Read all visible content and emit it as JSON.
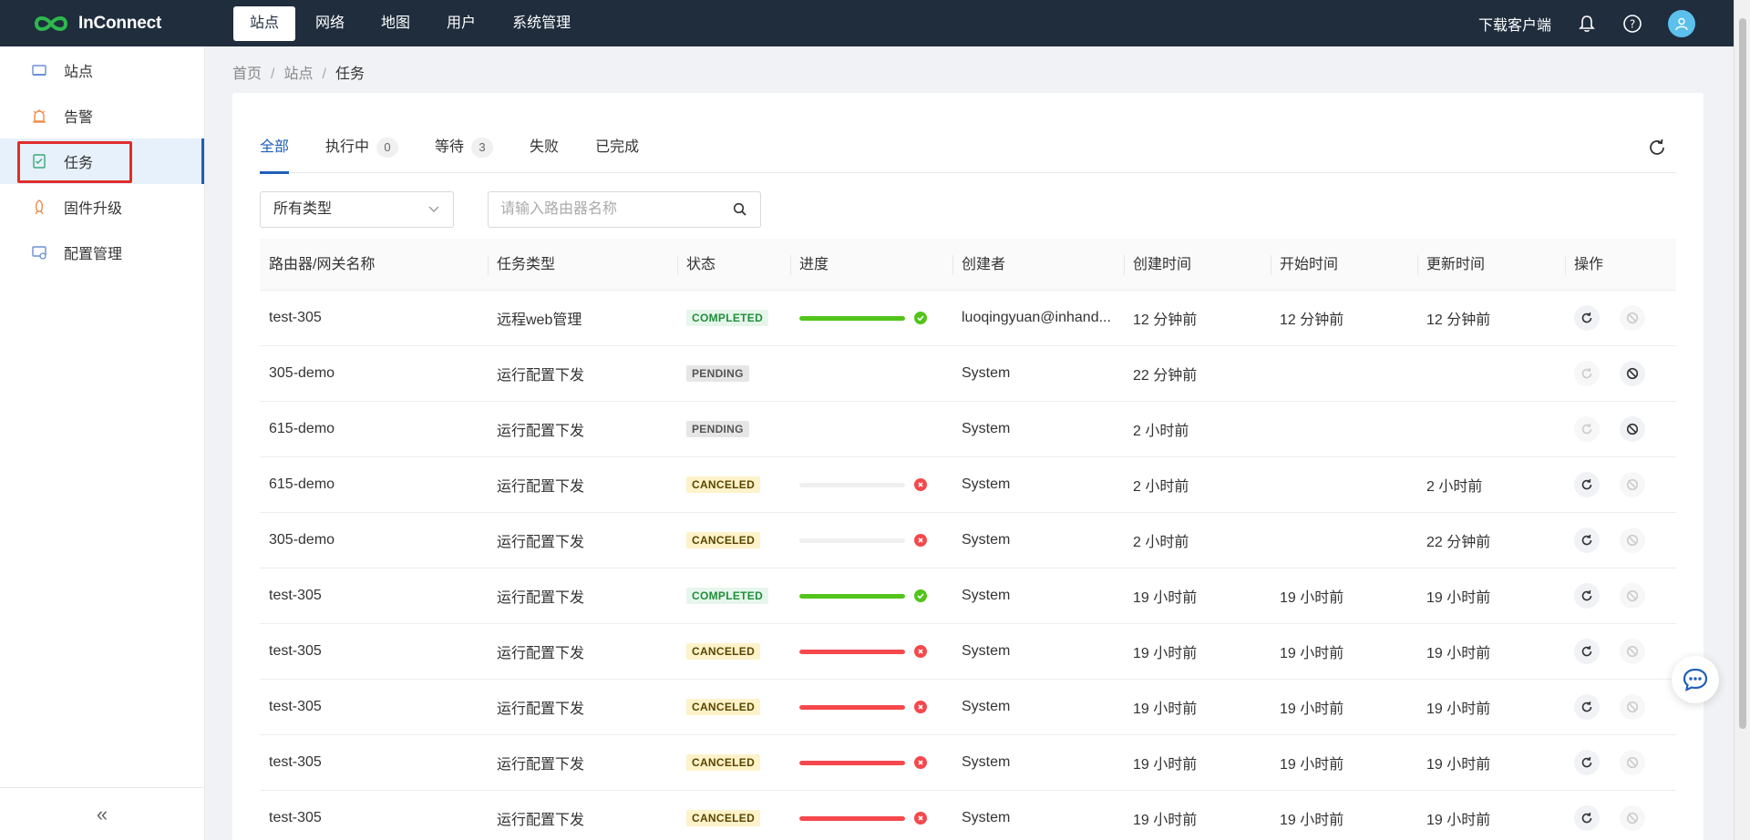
{
  "app": {
    "name": "InConnect"
  },
  "nav": {
    "items": [
      {
        "label": "站点",
        "active": true
      },
      {
        "label": "网络",
        "active": false
      },
      {
        "label": "地图",
        "active": false
      },
      {
        "label": "用户",
        "active": false
      },
      {
        "label": "系统管理",
        "active": false
      }
    ],
    "download_label": "下载客户端",
    "icons": [
      "bell-icon",
      "help-icon",
      "user-avatar-icon"
    ]
  },
  "sidebar": {
    "items": [
      {
        "label": "站点",
        "icon": "site-icon",
        "active": false
      },
      {
        "label": "告警",
        "icon": "alarm-icon",
        "active": false
      },
      {
        "label": "任务",
        "icon": "task-icon",
        "active": true
      },
      {
        "label": "固件升级",
        "icon": "firmware-icon",
        "active": false
      },
      {
        "label": "配置管理",
        "icon": "config-icon",
        "active": false
      }
    ],
    "collapse_label": "«"
  },
  "breadcrumb": {
    "items": [
      "首页",
      "站点",
      "任务"
    ],
    "separator": "/"
  },
  "tabs": [
    {
      "label": "全部",
      "count": null,
      "active": true
    },
    {
      "label": "执行中",
      "count": "0",
      "active": false
    },
    {
      "label": "等待",
      "count": "3",
      "active": false
    },
    {
      "label": "失败",
      "count": null,
      "active": false
    },
    {
      "label": "已完成",
      "count": null,
      "active": false
    }
  ],
  "filters": {
    "type_select": "所有类型",
    "search_placeholder": "请输入路由器名称"
  },
  "table": {
    "columns": [
      "路由器/网关名称",
      "任务类型",
      "状态",
      "进度",
      "创建者",
      "创建时间",
      "开始时间",
      "更新时间",
      "操作"
    ],
    "rows": [
      {
        "name": "test-305",
        "type": "远程web管理",
        "status": "COMPLETED",
        "progress": 1.0,
        "result": "success",
        "creator": "luoqingyuan@inhand...",
        "created": "12 分钟前",
        "started": "12 分钟前",
        "updated": "12 分钟前",
        "retry_enabled": true,
        "cancel_enabled": false
      },
      {
        "name": "305-demo",
        "type": "运行配置下发",
        "status": "PENDING",
        "progress": null,
        "result": null,
        "creator": "System",
        "created": "22 分钟前",
        "started": "",
        "updated": "",
        "retry_enabled": false,
        "cancel_enabled": true
      },
      {
        "name": "615-demo",
        "type": "运行配置下发",
        "status": "PENDING",
        "progress": null,
        "result": null,
        "creator": "System",
        "created": "2 小时前",
        "started": "",
        "updated": "",
        "retry_enabled": false,
        "cancel_enabled": true
      },
      {
        "name": "615-demo",
        "type": "运行配置下发",
        "status": "CANCELED",
        "progress": 0.0,
        "result": "error",
        "creator": "System",
        "created": "2 小时前",
        "started": "",
        "updated": "2 小时前",
        "retry_enabled": true,
        "cancel_enabled": false
      },
      {
        "name": "305-demo",
        "type": "运行配置下发",
        "status": "CANCELED",
        "progress": 0.0,
        "result": "error",
        "creator": "System",
        "created": "2 小时前",
        "started": "",
        "updated": "22 分钟前",
        "retry_enabled": true,
        "cancel_enabled": false
      },
      {
        "name": "test-305",
        "type": "运行配置下发",
        "status": "COMPLETED",
        "progress": 1.0,
        "result": "success",
        "creator": "System",
        "created": "19 小时前",
        "started": "19 小时前",
        "updated": "19 小时前",
        "retry_enabled": true,
        "cancel_enabled": false
      },
      {
        "name": "test-305",
        "type": "运行配置下发",
        "status": "CANCELED",
        "progress": 1.0,
        "result": "error",
        "creator": "System",
        "created": "19 小时前",
        "started": "19 小时前",
        "updated": "19 小时前",
        "retry_enabled": true,
        "cancel_enabled": false
      },
      {
        "name": "test-305",
        "type": "运行配置下发",
        "status": "CANCELED",
        "progress": 1.0,
        "result": "error",
        "creator": "System",
        "created": "19 小时前",
        "started": "19 小时前",
        "updated": "19 小时前",
        "retry_enabled": true,
        "cancel_enabled": false
      },
      {
        "name": "test-305",
        "type": "运行配置下发",
        "status": "CANCELED",
        "progress": 1.0,
        "result": "error",
        "creator": "System",
        "created": "19 小时前",
        "started": "19 小时前",
        "updated": "19 小时前",
        "retry_enabled": true,
        "cancel_enabled": false
      },
      {
        "name": "test-305",
        "type": "运行配置下发",
        "status": "CANCELED",
        "progress": 1.0,
        "result": "error",
        "creator": "System",
        "created": "19 小时前",
        "started": "19 小时前",
        "updated": "19 小时前",
        "retry_enabled": true,
        "cancel_enabled": false
      }
    ]
  },
  "colors": {
    "nav_bg": "#1f2d3d",
    "accent": "#1f5fb7",
    "success": "#52c41a",
    "error": "#f5484d",
    "highlight_box": "#e02d2d"
  }
}
